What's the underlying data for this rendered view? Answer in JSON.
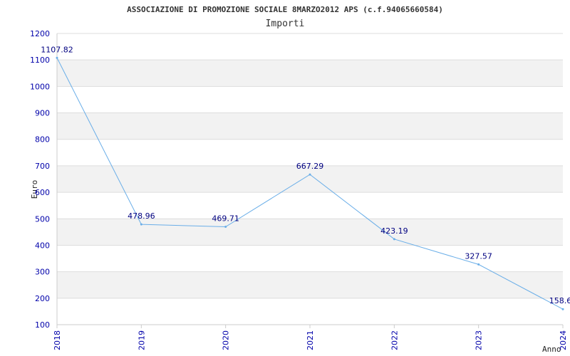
{
  "chart_data": {
    "type": "line",
    "title": "ASSOCIAZIONE DI PROMOZIONE SOCIALE 8MARZO2012 APS (c.f.94065660584)",
    "subtitle": "Importi",
    "xlabel": "Anno",
    "ylabel": "Euro",
    "categories": [
      "2018",
      "2019",
      "2020",
      "2021",
      "2022",
      "2023",
      "2024"
    ],
    "series": [
      {
        "values": [
          1107.82,
          478.96,
          469.71,
          667.29,
          423.19,
          327.57,
          158.6
        ],
        "labels": [
          "1107.82",
          "478.96",
          "469.71",
          "667.29",
          "423.19",
          "327.57",
          "158.60"
        ]
      }
    ],
    "ylim": [
      100,
      1200
    ],
    "yticks": [
      100,
      200,
      300,
      400,
      500,
      600,
      700,
      800,
      900,
      1000,
      1100,
      1200
    ],
    "grid": true,
    "legend": "none",
    "colors": {
      "line": "#6aaee8",
      "band": "#f2f2f2",
      "grid": "#dddddd",
      "axis": "#cccccc",
      "tick_text": "#0000aa",
      "data_label": "#000080"
    }
  }
}
